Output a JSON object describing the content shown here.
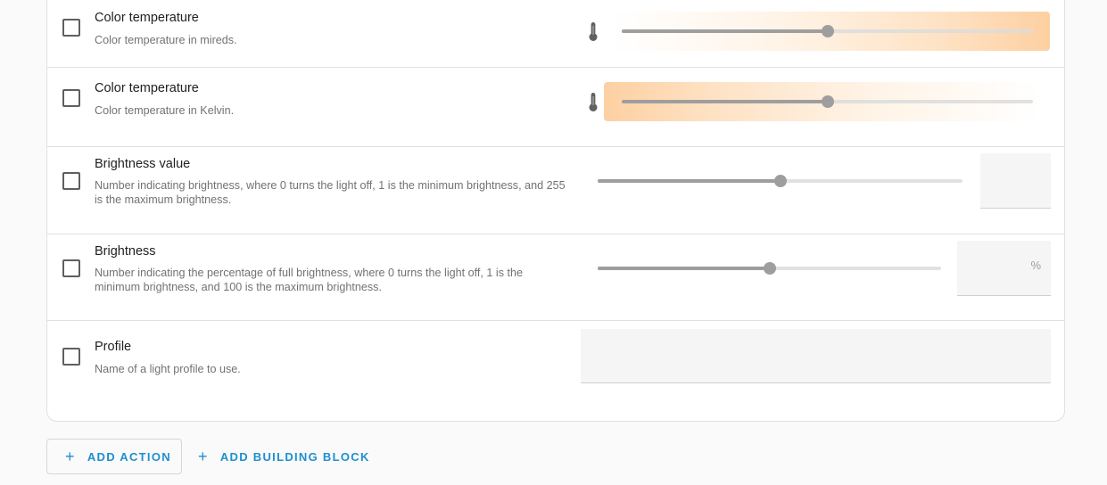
{
  "fields": [
    {
      "id": "color_temp_mireds",
      "title": "Color temperature",
      "description": "Color temperature in mireds.",
      "control": "color-temp-slider",
      "gradient": "warm-right",
      "value_fraction": 0.5
    },
    {
      "id": "color_temp_kelvin",
      "title": "Color temperature",
      "description": "Color temperature in Kelvin.",
      "control": "color-temp-slider",
      "gradient": "warm-left",
      "value_fraction": 0.5
    },
    {
      "id": "brightness_value",
      "title": "Brightness value",
      "description": "Number indicating brightness, where 0 turns the light off, 1 is the minimum brightness, and 255 is the maximum brightness.",
      "control": "slider-with-number",
      "value": "",
      "value_fraction": 0.5
    },
    {
      "id": "brightness_pct",
      "title": "Brightness",
      "description": "Number indicating the percentage of full brightness, where 0 turns the light off, 1 is the minimum brightness, and 100 is the maximum brightness.",
      "control": "slider-with-number",
      "value": "",
      "unit": "%",
      "value_fraction": 0.5
    },
    {
      "id": "profile",
      "title": "Profile",
      "description": "Name of a light profile to use.",
      "control": "text-input",
      "value": ""
    }
  ],
  "actions": {
    "add_action": "ADD ACTION",
    "add_building_block": "ADD BUILDING BLOCK"
  },
  "icons": {
    "thermometer": "thermometer-icon",
    "plus": "plus-icon"
  },
  "colors": {
    "accent": "#1e8fd0",
    "warm": "#fdd0a2",
    "slider_active": "#9e9e9e",
    "slider_inactive": "#dcdcdc"
  }
}
